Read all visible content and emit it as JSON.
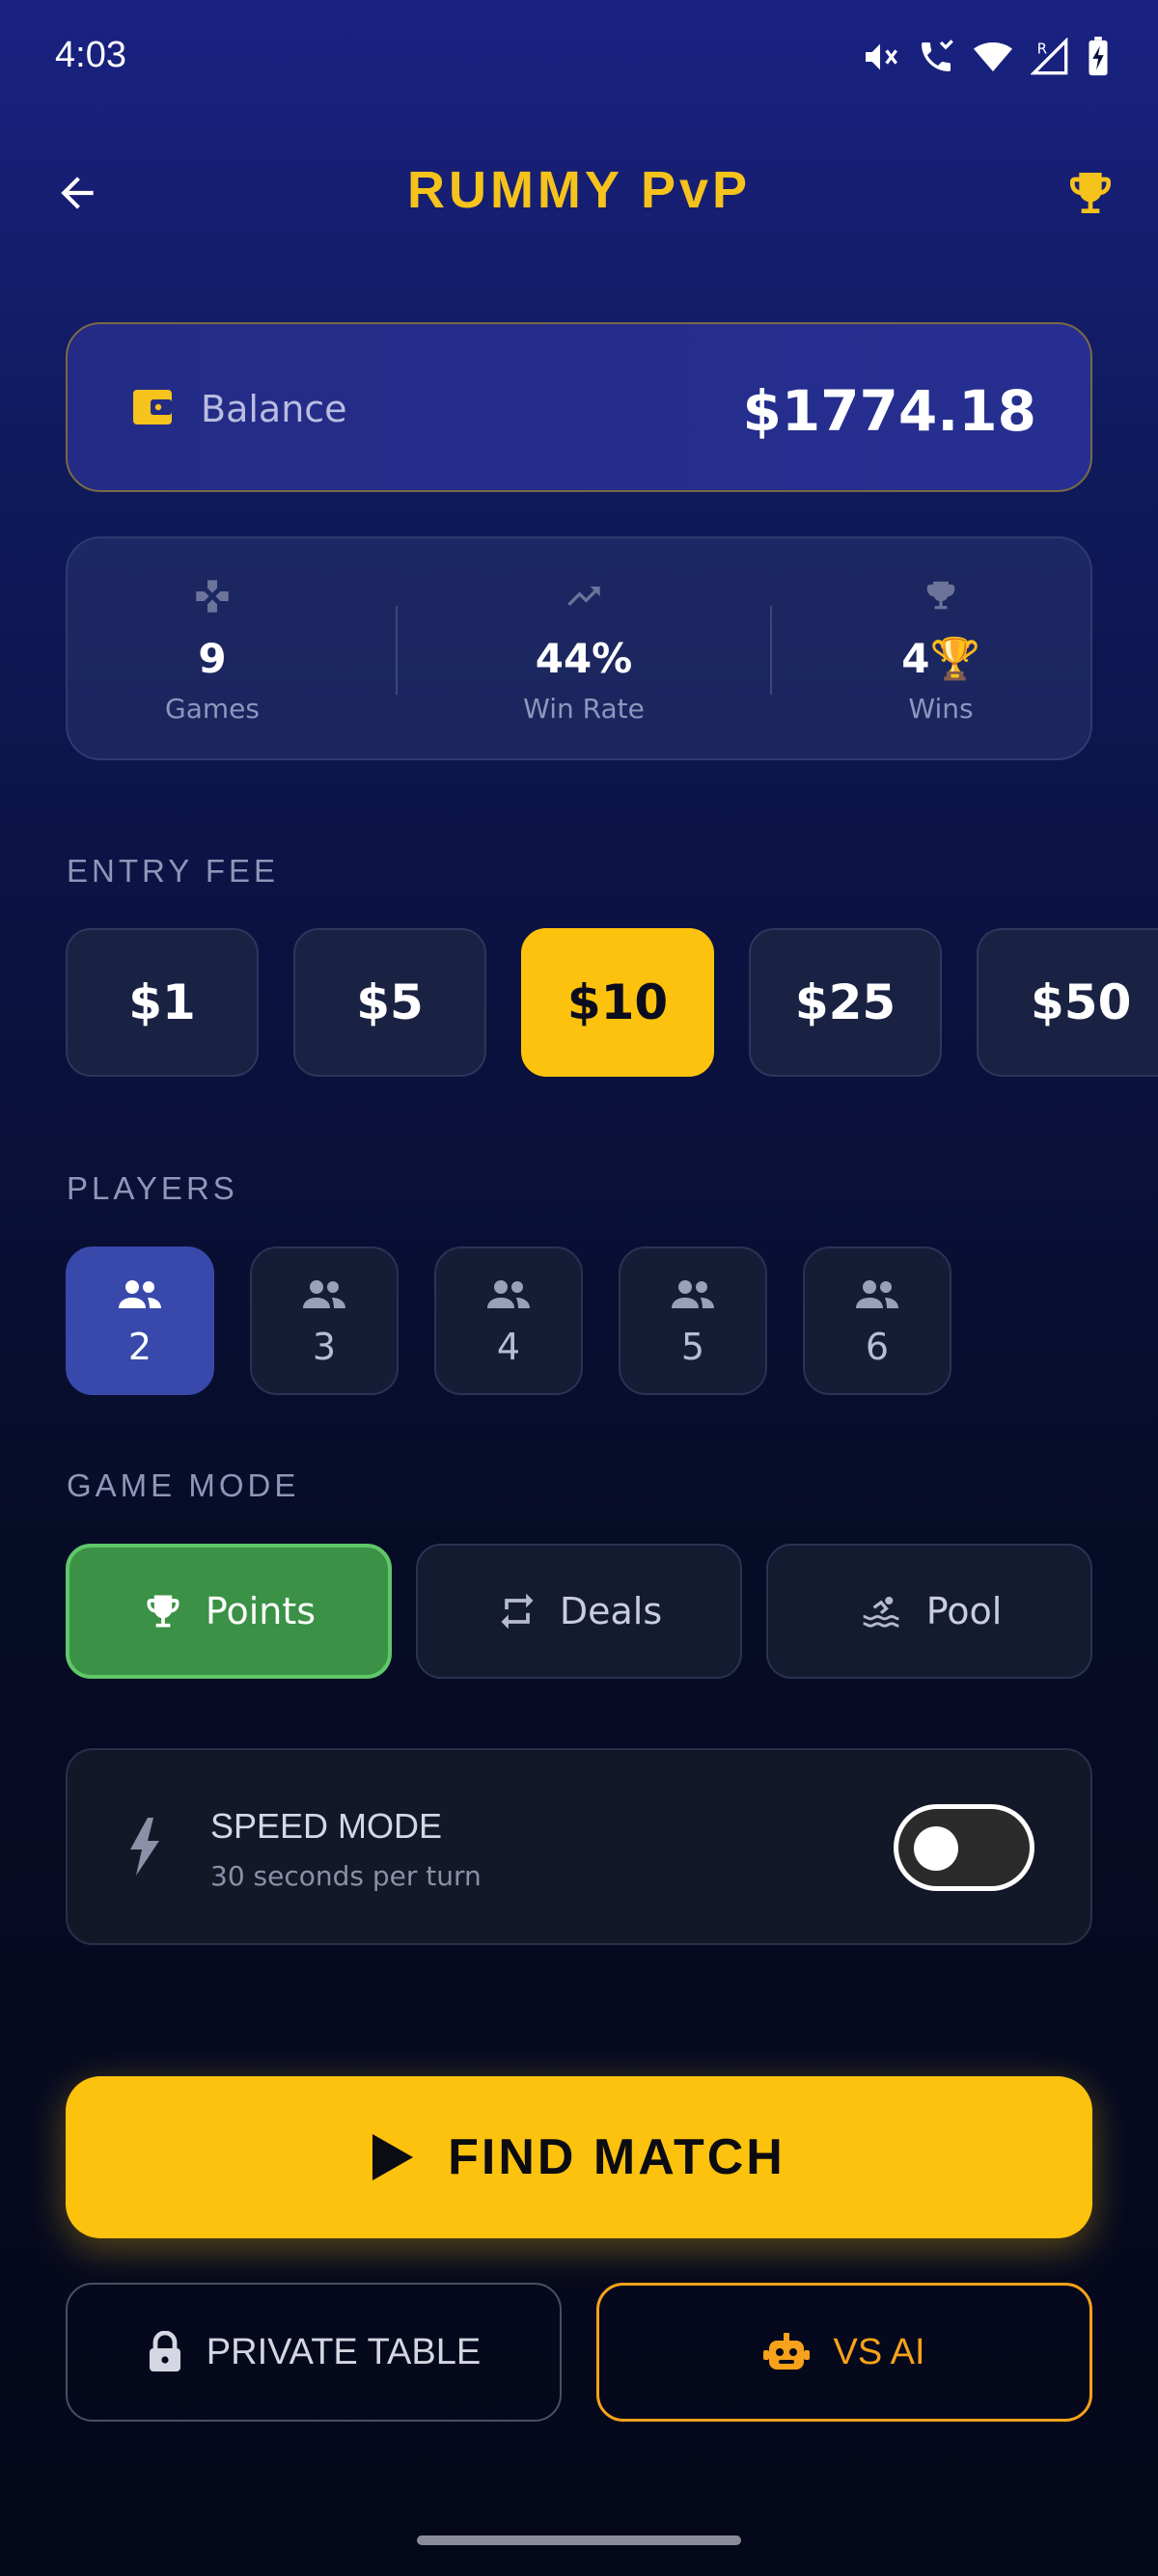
{
  "status_bar": {
    "time": "4:03"
  },
  "header": {
    "title": "RUMMY PvP"
  },
  "balance": {
    "label": "Balance",
    "value": "$1774.18"
  },
  "stats": {
    "games": {
      "value": "9",
      "label": "Games"
    },
    "win_rate": {
      "value": "44%",
      "label": "Win Rate"
    },
    "wins": {
      "value": "4🏆",
      "label": "Wins"
    }
  },
  "entry_fee": {
    "label": "ENTRY FEE",
    "options": [
      "$1",
      "$5",
      "$10",
      "$25",
      "$50"
    ],
    "selected": "$10"
  },
  "players": {
    "label": "PLAYERS",
    "options": [
      "2",
      "3",
      "4",
      "5",
      "6"
    ],
    "selected": "2"
  },
  "game_mode": {
    "label": "GAME MODE",
    "options": [
      "Points",
      "Deals",
      "Pool"
    ],
    "selected": "Points"
  },
  "speed_mode": {
    "title": "SPEED MODE",
    "subtitle": "30 seconds per turn",
    "enabled": false
  },
  "actions": {
    "find_match": "FIND MATCH",
    "private_table": "PRIVATE TABLE",
    "vs_ai": "VS AI"
  },
  "colors": {
    "accent_yellow": "#fcc20d",
    "title_yellow": "#f6c21c",
    "selected_blue": "#3949ab",
    "selected_green": "#3b9145",
    "ai_orange": "#f7a21b"
  },
  "icons": [
    "back-arrow-icon",
    "trophy-icon",
    "wallet-icon",
    "gamepad-icon",
    "trending-up-icon",
    "people-icon",
    "swap-icon",
    "pool-icon",
    "bolt-icon",
    "play-icon",
    "lock-icon",
    "robot-icon"
  ]
}
